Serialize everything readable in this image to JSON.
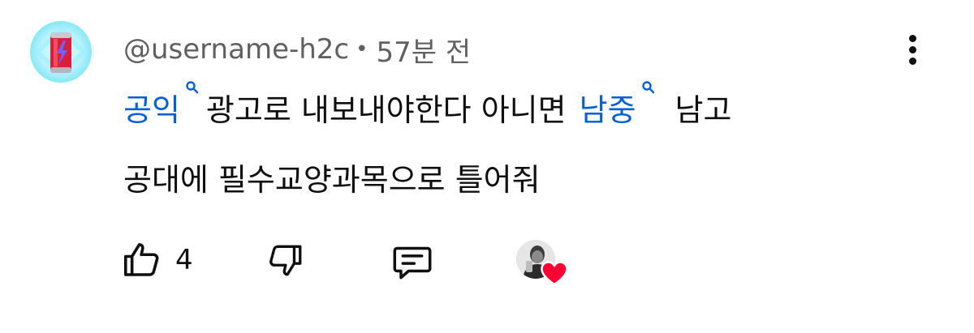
{
  "comment": {
    "author": "@username-h2c",
    "separator": "•",
    "time": "57분 전",
    "segments": [
      {
        "text": "공익",
        "kind": "search-link"
      },
      {
        "text": "광고로 내보내야한다 아니면",
        "kind": "plain"
      },
      {
        "text": "남중",
        "kind": "search-link"
      },
      {
        "text": "남고",
        "kind": "plain"
      },
      {
        "text": "공대에 필수교양과목으로 틀어줘",
        "kind": "plain"
      }
    ]
  },
  "actions": {
    "like_count": "4"
  },
  "icons": {
    "avatar": "energy-drink-can-avatar",
    "more": "vertical-ellipsis-icon",
    "search": "search-icon",
    "like": "thumbs-up-icon",
    "dislike": "thumbs-down-icon",
    "reply": "comment-icon",
    "creator_heart": "red-heart-icon"
  },
  "colors": {
    "link": "#065fd4",
    "meta_text": "#606060",
    "body_text": "#0f0f0f",
    "heart": "#ff0033"
  }
}
